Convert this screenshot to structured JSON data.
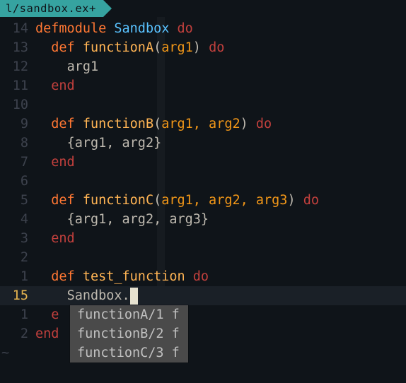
{
  "tab": {
    "label": "l/sandbox.ex+"
  },
  "gutter": {
    "before": [
      "14",
      "13",
      "12",
      "11",
      "10",
      "9",
      "8",
      "7",
      "6",
      "5",
      "4",
      "3",
      "2",
      "1"
    ],
    "current": "15",
    "after": [
      "1",
      "2"
    ]
  },
  "code": {
    "l14": {
      "kw": "defmodule",
      "mod": "Sandbox",
      "do": "do"
    },
    "l13": {
      "kw": "def",
      "fn": "functionA",
      "args": "arg1",
      "do": "do"
    },
    "l12": {
      "body": "arg1"
    },
    "l11": {
      "end": "end"
    },
    "l10": {
      "blank": ""
    },
    "l9": {
      "kw": "def",
      "fn": "functionB",
      "args": "arg1, arg2",
      "do": "do"
    },
    "l8": {
      "body": "{arg1, arg2}"
    },
    "l7": {
      "end": "end"
    },
    "l6": {
      "blank": ""
    },
    "l5": {
      "kw": "def",
      "fn": "functionC",
      "args": "arg1, arg2, arg3",
      "do": "do"
    },
    "l4": {
      "body": "{arg1, arg2, arg3}"
    },
    "l3": {
      "end": "end"
    },
    "l2": {
      "blank": ""
    },
    "l1": {
      "kw": "def",
      "fn": "test_function",
      "do": "do"
    },
    "cur": {
      "mod": "Sandbox",
      "dot": "."
    },
    "a1": {
      "end_inner": "e"
    },
    "a2": {
      "end_outer": "end"
    }
  },
  "popup": {
    "items": [
      {
        "label": "functionA/1",
        "kind": "f"
      },
      {
        "label": "functionB/2",
        "kind": "f"
      },
      {
        "label": "functionC/3",
        "kind": "f"
      }
    ]
  },
  "tilde": "~",
  "colors": {
    "bg": "#0f1419",
    "accent": "#e6b450",
    "keyword": "#ff7733",
    "do_end": "#c2403d",
    "function": "#ffb454",
    "module": "#59c2ff",
    "param": "#f29718",
    "tab_bg": "#36a3a0"
  }
}
